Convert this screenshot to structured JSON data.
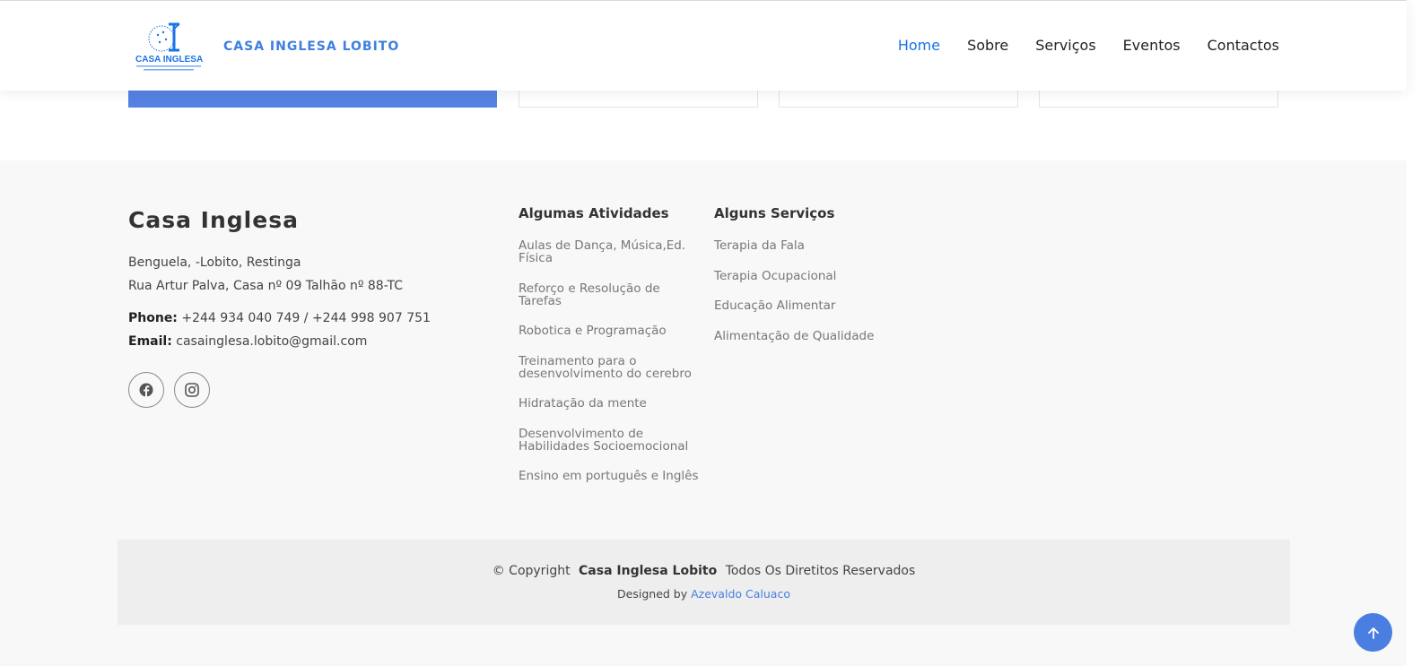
{
  "header": {
    "logo_text": "CASA INGLESA",
    "brand": "CASA INGLESA LOBITO",
    "nav": [
      {
        "label": "Home",
        "active": true
      },
      {
        "label": "Sobre",
        "active": false
      },
      {
        "label": "Serviços",
        "active": false
      },
      {
        "label": "Eventos",
        "active": false
      },
      {
        "label": "Contactos",
        "active": false
      }
    ]
  },
  "footer": {
    "title": "Casa Inglesa",
    "address_line1": "Benguela, -Lobito, Restinga",
    "address_line2": "Rua Artur Palva, Casa nº 09 Talhão nº 88-TC",
    "phone_label": "Phone:",
    "phone": "+244 934 040 749 / +244 998 907 751",
    "email_label": "Email:",
    "email": "casainglesa.lobito@gmail.com",
    "socials": [
      "facebook-icon",
      "instagram-icon"
    ],
    "activities": {
      "title": "Algumas Atividades",
      "items": [
        "Aulas de Dança, Música,Ed. Física",
        "Reforço e Resolução de Tarefas",
        "Robotica e Programação",
        "Treinamento para o desenvolvimento do cerebro",
        "Hidratação da mente",
        "Desenvolvimento de Habilidades Socioemocional",
        "Ensino em português e Inglês"
      ]
    },
    "services": {
      "title": "Alguns Serviços",
      "items": [
        "Terapia da Fala",
        "Terapia Ocupacional",
        "Educação Alimentar",
        "Alimentação de Qualidade"
      ]
    },
    "copyright_prefix": "© Copyright",
    "copyright_name": "Casa Inglesa Lobito",
    "copyright_suffix": "Todos Os Diretitos Reservados",
    "designed_by": "Designed by",
    "designer": "Azevaldo Caluaco"
  },
  "colors": {
    "accent": "#4a7ee0",
    "nav_active": "#1a73e8",
    "footer_bg": "#f8f8f8",
    "copyright_bg": "#eeeeee"
  },
  "back_to_top_icon": "arrow-up-icon"
}
